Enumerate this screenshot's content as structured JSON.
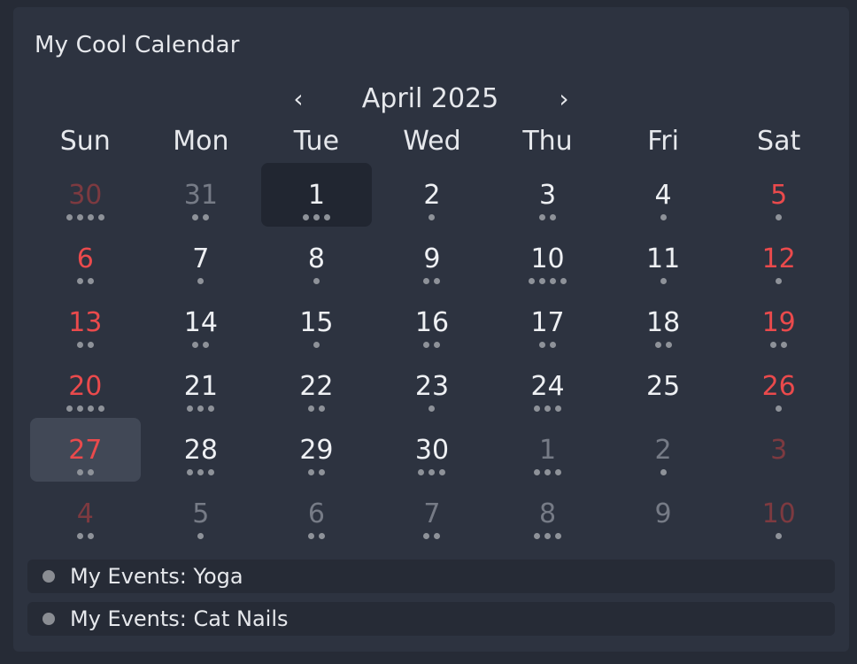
{
  "calendar": {
    "title": "My Cool Calendar",
    "month_label": "April 2025",
    "prev_label": "‹",
    "next_label": "›",
    "weekdays": [
      "Sun",
      "Mon",
      "Tue",
      "Wed",
      "Thu",
      "Fri",
      "Sat"
    ],
    "days": [
      {
        "label": "30",
        "kind": "outside-weekend",
        "dots": 4
      },
      {
        "label": "31",
        "kind": "outside",
        "dots": 2
      },
      {
        "label": "1",
        "kind": "normal",
        "dots": 3,
        "state": "today"
      },
      {
        "label": "2",
        "kind": "normal",
        "dots": 1
      },
      {
        "label": "3",
        "kind": "normal",
        "dots": 2
      },
      {
        "label": "4",
        "kind": "normal",
        "dots": 1
      },
      {
        "label": "5",
        "kind": "weekend",
        "dots": 1
      },
      {
        "label": "6",
        "kind": "weekend",
        "dots": 2
      },
      {
        "label": "7",
        "kind": "normal",
        "dots": 1
      },
      {
        "label": "8",
        "kind": "normal",
        "dots": 1
      },
      {
        "label": "9",
        "kind": "normal",
        "dots": 2
      },
      {
        "label": "10",
        "kind": "normal",
        "dots": 4
      },
      {
        "label": "11",
        "kind": "normal",
        "dots": 1
      },
      {
        "label": "12",
        "kind": "weekend",
        "dots": 1
      },
      {
        "label": "13",
        "kind": "weekend",
        "dots": 2
      },
      {
        "label": "14",
        "kind": "normal",
        "dots": 2
      },
      {
        "label": "15",
        "kind": "normal",
        "dots": 1
      },
      {
        "label": "16",
        "kind": "normal",
        "dots": 2
      },
      {
        "label": "17",
        "kind": "normal",
        "dots": 2
      },
      {
        "label": "18",
        "kind": "normal",
        "dots": 2
      },
      {
        "label": "19",
        "kind": "weekend",
        "dots": 2
      },
      {
        "label": "20",
        "kind": "weekend",
        "dots": 4
      },
      {
        "label": "21",
        "kind": "normal",
        "dots": 3
      },
      {
        "label": "22",
        "kind": "normal",
        "dots": 2
      },
      {
        "label": "23",
        "kind": "normal",
        "dots": 1
      },
      {
        "label": "24",
        "kind": "normal",
        "dots": 3
      },
      {
        "label": "25",
        "kind": "normal",
        "dots": 0
      },
      {
        "label": "26",
        "kind": "weekend",
        "dots": 1
      },
      {
        "label": "27",
        "kind": "weekend",
        "dots": 2,
        "state": "selected"
      },
      {
        "label": "28",
        "kind": "normal",
        "dots": 3
      },
      {
        "label": "29",
        "kind": "normal",
        "dots": 2
      },
      {
        "label": "30",
        "kind": "normal",
        "dots": 3
      },
      {
        "label": "1",
        "kind": "outside",
        "dots": 3
      },
      {
        "label": "2",
        "kind": "outside",
        "dots": 1
      },
      {
        "label": "3",
        "kind": "outside-weekend",
        "dots": 0
      },
      {
        "label": "4",
        "kind": "outside-weekend",
        "dots": 2
      },
      {
        "label": "5",
        "kind": "outside",
        "dots": 1
      },
      {
        "label": "6",
        "kind": "outside",
        "dots": 2
      },
      {
        "label": "7",
        "kind": "outside",
        "dots": 2
      },
      {
        "label": "8",
        "kind": "outside",
        "dots": 3
      },
      {
        "label": "9",
        "kind": "outside",
        "dots": 0
      },
      {
        "label": "10",
        "kind": "outside-weekend",
        "dots": 1
      }
    ],
    "events": [
      {
        "label": "My Events: Yoga",
        "color": "#8a8d93"
      },
      {
        "label": "My Events: Cat Nails",
        "color": "#8a8d93"
      }
    ]
  },
  "colors": {
    "weekend": "#ea4a4c",
    "outside": "#767b86",
    "outside_weekend": "#7d3a40",
    "dot": "#8e9299"
  }
}
